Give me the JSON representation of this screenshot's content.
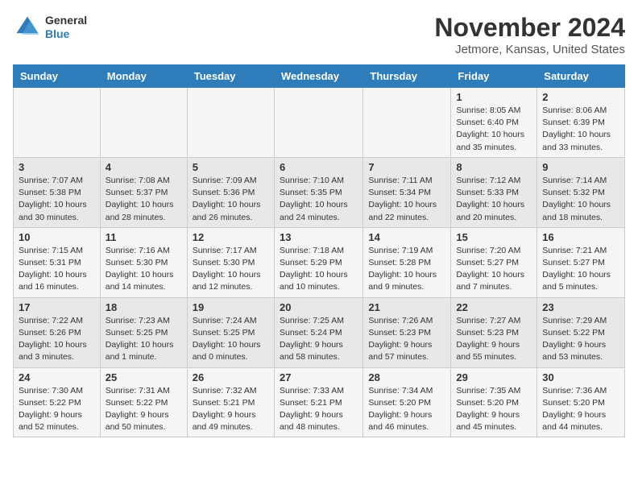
{
  "header": {
    "logo": {
      "line1": "General",
      "line2": "Blue"
    },
    "title": "November 2024",
    "location": "Jetmore, Kansas, United States"
  },
  "weekdays": [
    "Sunday",
    "Monday",
    "Tuesday",
    "Wednesday",
    "Thursday",
    "Friday",
    "Saturday"
  ],
  "weeks": [
    [
      {
        "day": "",
        "info": ""
      },
      {
        "day": "",
        "info": ""
      },
      {
        "day": "",
        "info": ""
      },
      {
        "day": "",
        "info": ""
      },
      {
        "day": "",
        "info": ""
      },
      {
        "day": "1",
        "info": "Sunrise: 8:05 AM\nSunset: 6:40 PM\nDaylight: 10 hours and 35 minutes."
      },
      {
        "day": "2",
        "info": "Sunrise: 8:06 AM\nSunset: 6:39 PM\nDaylight: 10 hours and 33 minutes."
      }
    ],
    [
      {
        "day": "3",
        "info": "Sunrise: 7:07 AM\nSunset: 5:38 PM\nDaylight: 10 hours and 30 minutes."
      },
      {
        "day": "4",
        "info": "Sunrise: 7:08 AM\nSunset: 5:37 PM\nDaylight: 10 hours and 28 minutes."
      },
      {
        "day": "5",
        "info": "Sunrise: 7:09 AM\nSunset: 5:36 PM\nDaylight: 10 hours and 26 minutes."
      },
      {
        "day": "6",
        "info": "Sunrise: 7:10 AM\nSunset: 5:35 PM\nDaylight: 10 hours and 24 minutes."
      },
      {
        "day": "7",
        "info": "Sunrise: 7:11 AM\nSunset: 5:34 PM\nDaylight: 10 hours and 22 minutes."
      },
      {
        "day": "8",
        "info": "Sunrise: 7:12 AM\nSunset: 5:33 PM\nDaylight: 10 hours and 20 minutes."
      },
      {
        "day": "9",
        "info": "Sunrise: 7:14 AM\nSunset: 5:32 PM\nDaylight: 10 hours and 18 minutes."
      }
    ],
    [
      {
        "day": "10",
        "info": "Sunrise: 7:15 AM\nSunset: 5:31 PM\nDaylight: 10 hours and 16 minutes."
      },
      {
        "day": "11",
        "info": "Sunrise: 7:16 AM\nSunset: 5:30 PM\nDaylight: 10 hours and 14 minutes."
      },
      {
        "day": "12",
        "info": "Sunrise: 7:17 AM\nSunset: 5:30 PM\nDaylight: 10 hours and 12 minutes."
      },
      {
        "day": "13",
        "info": "Sunrise: 7:18 AM\nSunset: 5:29 PM\nDaylight: 10 hours and 10 minutes."
      },
      {
        "day": "14",
        "info": "Sunrise: 7:19 AM\nSunset: 5:28 PM\nDaylight: 10 hours and 9 minutes."
      },
      {
        "day": "15",
        "info": "Sunrise: 7:20 AM\nSunset: 5:27 PM\nDaylight: 10 hours and 7 minutes."
      },
      {
        "day": "16",
        "info": "Sunrise: 7:21 AM\nSunset: 5:27 PM\nDaylight: 10 hours and 5 minutes."
      }
    ],
    [
      {
        "day": "17",
        "info": "Sunrise: 7:22 AM\nSunset: 5:26 PM\nDaylight: 10 hours and 3 minutes."
      },
      {
        "day": "18",
        "info": "Sunrise: 7:23 AM\nSunset: 5:25 PM\nDaylight: 10 hours and 1 minute."
      },
      {
        "day": "19",
        "info": "Sunrise: 7:24 AM\nSunset: 5:25 PM\nDaylight: 10 hours and 0 minutes."
      },
      {
        "day": "20",
        "info": "Sunrise: 7:25 AM\nSunset: 5:24 PM\nDaylight: 9 hours and 58 minutes."
      },
      {
        "day": "21",
        "info": "Sunrise: 7:26 AM\nSunset: 5:23 PM\nDaylight: 9 hours and 57 minutes."
      },
      {
        "day": "22",
        "info": "Sunrise: 7:27 AM\nSunset: 5:23 PM\nDaylight: 9 hours and 55 minutes."
      },
      {
        "day": "23",
        "info": "Sunrise: 7:29 AM\nSunset: 5:22 PM\nDaylight: 9 hours and 53 minutes."
      }
    ],
    [
      {
        "day": "24",
        "info": "Sunrise: 7:30 AM\nSunset: 5:22 PM\nDaylight: 9 hours and 52 minutes."
      },
      {
        "day": "25",
        "info": "Sunrise: 7:31 AM\nSunset: 5:22 PM\nDaylight: 9 hours and 50 minutes."
      },
      {
        "day": "26",
        "info": "Sunrise: 7:32 AM\nSunset: 5:21 PM\nDaylight: 9 hours and 49 minutes."
      },
      {
        "day": "27",
        "info": "Sunrise: 7:33 AM\nSunset: 5:21 PM\nDaylight: 9 hours and 48 minutes."
      },
      {
        "day": "28",
        "info": "Sunrise: 7:34 AM\nSunset: 5:20 PM\nDaylight: 9 hours and 46 minutes."
      },
      {
        "day": "29",
        "info": "Sunrise: 7:35 AM\nSunset: 5:20 PM\nDaylight: 9 hours and 45 minutes."
      },
      {
        "day": "30",
        "info": "Sunrise: 7:36 AM\nSunset: 5:20 PM\nDaylight: 9 hours and 44 minutes."
      }
    ]
  ]
}
